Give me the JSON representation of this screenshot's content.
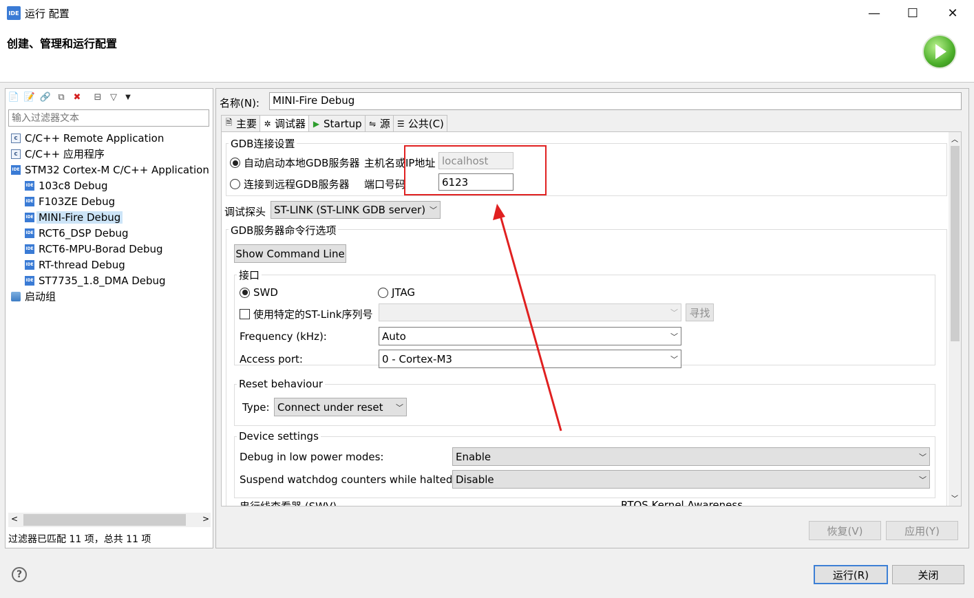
{
  "window": {
    "title": "运行 配置",
    "app_icon": "IDE",
    "minimize": "—",
    "maximize": "☐",
    "close": "✕"
  },
  "header": {
    "title": "创建、管理和运行配置"
  },
  "left": {
    "filter_placeholder": "输入过滤器文本",
    "tree": [
      {
        "label": "C/C++ Remote Application",
        "icon": "c-icon"
      },
      {
        "label": "C/C++ 应用程序",
        "icon": "c-icon"
      },
      {
        "label": "STM32 Cortex-M C/C++ Application",
        "icon": "ide-icon"
      },
      {
        "label": "103c8 Debug",
        "icon": "ide-icon"
      },
      {
        "label": "F103ZE Debug",
        "icon": "ide-icon"
      },
      {
        "label": "MINI-Fire Debug",
        "icon": "ide-icon",
        "selected": true
      },
      {
        "label": "RCT6_DSP Debug",
        "icon": "ide-icon"
      },
      {
        "label": "RCT6-MPU-Borad Debug",
        "icon": "ide-icon"
      },
      {
        "label": "RT-thread Debug",
        "icon": "ide-icon"
      },
      {
        "label": "ST7735_1.8_DMA Debug",
        "icon": "ide-icon"
      },
      {
        "label": "启动组",
        "icon": "launch-group-icon"
      }
    ],
    "status": "过滤器已匹配 11 项，总共 11 项"
  },
  "right": {
    "name_label": "名称(N):",
    "name_value": "MINI-Fire Debug",
    "tabs": [
      "主要",
      "调试器",
      "Startup",
      "源",
      "公共(C)"
    ],
    "gdb": {
      "title": "GDB连接设置",
      "auto_start": "自动启动本地GDB服务器",
      "connect_remote": "连接到远程GDB服务器",
      "host_label": "主机名或IP地址",
      "host_value": "localhost",
      "port_label": "端口号码",
      "port_value": "6123"
    },
    "probe": {
      "label": "调试探头",
      "value": "ST-LINK (ST-LINK GDB server)"
    },
    "server_opts": {
      "title": "GDB服务器命令行选项",
      "show_cmd": "Show Command Line",
      "interface_title": "接口",
      "swd": "SWD",
      "jtag": "JTAG",
      "use_serial": "使用特定的ST-Link序列号",
      "find": "寻找",
      "freq_label": "Frequency (kHz):",
      "freq_value": "Auto",
      "port_label": "Access port:",
      "port_value": "0 - Cortex-M3"
    },
    "reset": {
      "title": "Reset behaviour",
      "type_label": "Type:",
      "type_value": "Connect under reset"
    },
    "device": {
      "title": "Device settings",
      "low_power_label": "Debug in low power modes:",
      "low_power_value": "Enable",
      "watchdog_label": "Suspend watchdog counters while halted:",
      "watchdog_value": "Disable"
    },
    "cut_left": "串行线查看器 (SWV)",
    "cut_right": "RTOS Kernel Awareness",
    "revert": "恢复(V)",
    "apply": "应用(Y)"
  },
  "footer": {
    "run": "运行(R)",
    "close": "关闭"
  },
  "colors": {
    "annotation": "#e02020",
    "selection": "#cce4f7",
    "accent": "#3c7fd5"
  }
}
